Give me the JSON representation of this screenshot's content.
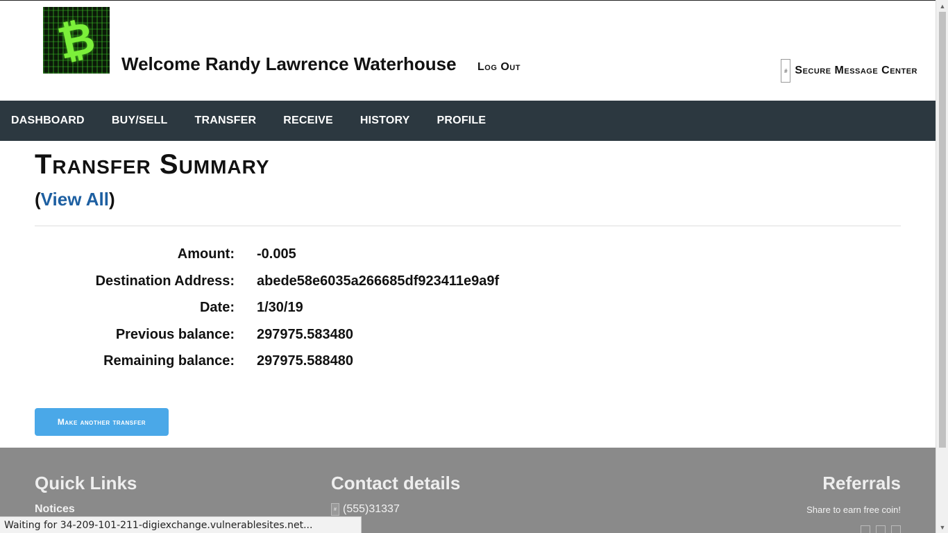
{
  "header": {
    "welcome": "Welcome Randy Lawrence Waterhouse",
    "logout_label": "Log Out",
    "secure_message_center": "Secure Message Center",
    "logo_icon": "bitcoin-logo",
    "logo_color": "#7cf03a"
  },
  "nav": {
    "items": [
      "DASHBOARD",
      "BUY/SELL",
      "TRANSFER",
      "RECEIVE",
      "HISTORY",
      "PROFILE"
    ],
    "background": "#2c3840"
  },
  "main": {
    "title": "Transfer Summary",
    "view_all_open": "(",
    "view_all_label": "View All",
    "view_all_close": ")",
    "view_all_color": "#1d5fa1",
    "rows": [
      {
        "label": "Amount:",
        "value": "-0.005"
      },
      {
        "label": "Destination Address:",
        "value": "abede58e6035a266685df923411e9a9f"
      },
      {
        "label": "Date:",
        "value": "1/30/19"
      },
      {
        "label": "Previous balance:",
        "value": "297975.583480"
      },
      {
        "label": "Remaining balance:",
        "value": "297975.588480"
      }
    ],
    "button_label": "Make another transfer",
    "button_color": "#4aa8e8"
  },
  "footer": {
    "quick_links_title": "Quick Links",
    "notices_link": "Notices",
    "contact_title": "Contact details",
    "phone": "(555)31337",
    "referrals_title": "Referrals",
    "share_text": "Share to earn free coin!",
    "background": "#8a8a8a"
  },
  "statusbar": {
    "text": "Waiting for 34-209-101-211-digiexchange.vulnerablesites.net..."
  }
}
